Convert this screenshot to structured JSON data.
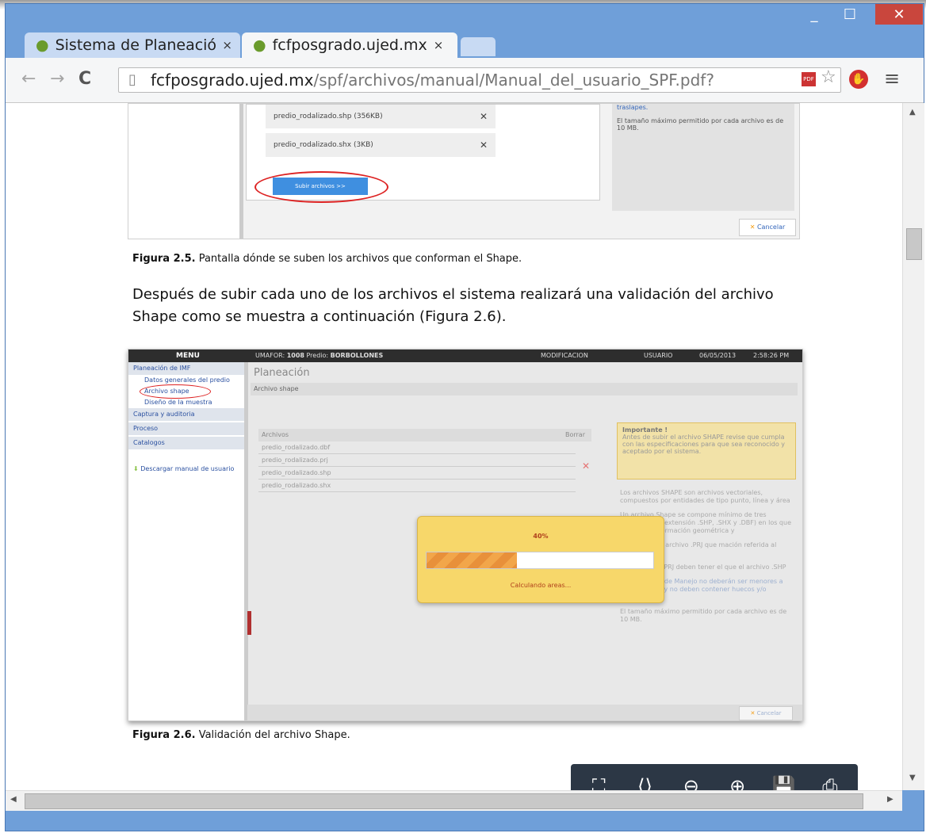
{
  "browser": {
    "tabs": [
      {
        "title": "Sistema de Planeació",
        "close": "×"
      },
      {
        "title": "fcfposgrado.ujed.mx",
        "close": "×"
      }
    ],
    "window_controls": {
      "minimize": "_",
      "maximize": "☐",
      "close": "✕"
    },
    "address": {
      "host": "fcfposgrado.ujed.mx",
      "path": "/spf/archivos/manual/Manual_del_usuario_SPF.pdf?"
    }
  },
  "doc": {
    "fig25": {
      "files": [
        {
          "name": "predio_rodalizado.shp (356KB)",
          "remove": "✕"
        },
        {
          "name": "predio_rodalizado.shx (3KB)",
          "remove": "✕"
        }
      ],
      "upload_button": "Subir archivos >>",
      "right_title": "traslapes.",
      "right_note": "El tamaño máximo permitido por cada archivo es de 10 MB.",
      "cancel": "Cancelar",
      "caption_bold": "Figura 2.5.",
      "caption_text": " Pantalla dónde se suben los archivos que conforman el Shape."
    },
    "paragraph": "Después de subir cada uno de los archivos el sistema realizará una validación del archivo Shape como se muestra a continuación (Figura 2.6).",
    "fig26": {
      "menu_header": "MENU",
      "topbar": {
        "umafor_label": "UMAFOR:",
        "umafor_value": "1008",
        "predio_label": "Predio:",
        "predio_value": "BORBOLLONES",
        "mode": "MODIFICACION",
        "user": "USUARIO",
        "date": "06/05/2013",
        "time": "2:58:26 PM"
      },
      "menu_items": [
        {
          "label": "Planeación de IMF",
          "type": "section"
        },
        {
          "label": "Datos generales del predio",
          "type": "sub"
        },
        {
          "label": "Archivo shape",
          "type": "sub"
        },
        {
          "label": "Diseño de la muestra",
          "type": "sub"
        },
        {
          "label": "Captura y auditoria",
          "type": "section"
        },
        {
          "label": "Proceso",
          "type": "section"
        },
        {
          "label": "Catalogos",
          "type": "section"
        }
      ],
      "download_manual": "Descargar manual de usuario",
      "page_title": "Planeación",
      "panel_title": "Archivo shape",
      "table_headers": {
        "files": "Archivos",
        "delete": "Borrar"
      },
      "table_rows": [
        "predio_rodalizado.dbf",
        "predio_rodalizado.prj",
        "predio_rodalizado.shp",
        "predio_rodalizado.shx"
      ],
      "important_title": "Importante !",
      "important_text": "Antes de subir el archivo SHAPE revise que cumpla con las especificaciones para que sea reconocido y aceptado por el sistema.",
      "info_1": "Los archivos SHAPE son archivos vectoriales, compuestos por entidades de tipo punto, línea y área",
      "info_2": "Un archivo Shape se compone mínimo de tres archivos (con extensión .SHP, .SHX y .DBF) en los que almacena información geométrica y",
      "info_3": "se requiere el archivo .PRJ que mación referida al sistema de",
      "info_4": ".SHX, .DBF y .PRJ deben tener el que el archivo .SHP",
      "info_5": "Las Unidades de Manejo no deberán ser menores a una hectárea y no deben contener huecos y/o traslapes.",
      "info_6": "El tamaño máximo permitido por cada archivo es de 10 MB.",
      "progress_label": "40%",
      "progress_value": 0.4,
      "progress_status": "Calculando areas...",
      "cancel": "Cancelar",
      "caption_bold": "Figura 2.6.",
      "caption_text": " Validación del archivo Shape."
    }
  },
  "pdf_toolbar": [
    "fit-page-icon",
    "fit-width-icon",
    "zoom-out-icon",
    "zoom-in-icon",
    "save-icon",
    "print-icon"
  ]
}
